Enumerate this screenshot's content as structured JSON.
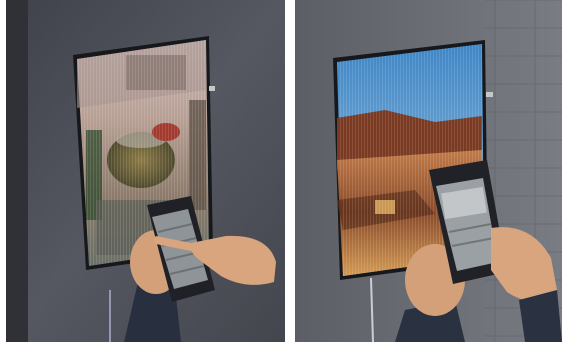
{
  "image": {
    "description_panels": [
      "left-photo",
      "right-photo"
    ],
    "colors": {
      "wall_left": "#4a4d55",
      "wall_right": "#6e7079",
      "sleeve": "#2a3140",
      "skin": "#d9a57f",
      "phone": "#24262b",
      "phone_screen": "#8a8f93",
      "sky": "#4d8fc8",
      "desert": "#b56a3a",
      "mirror_frame": "#1b1b1f"
    }
  }
}
